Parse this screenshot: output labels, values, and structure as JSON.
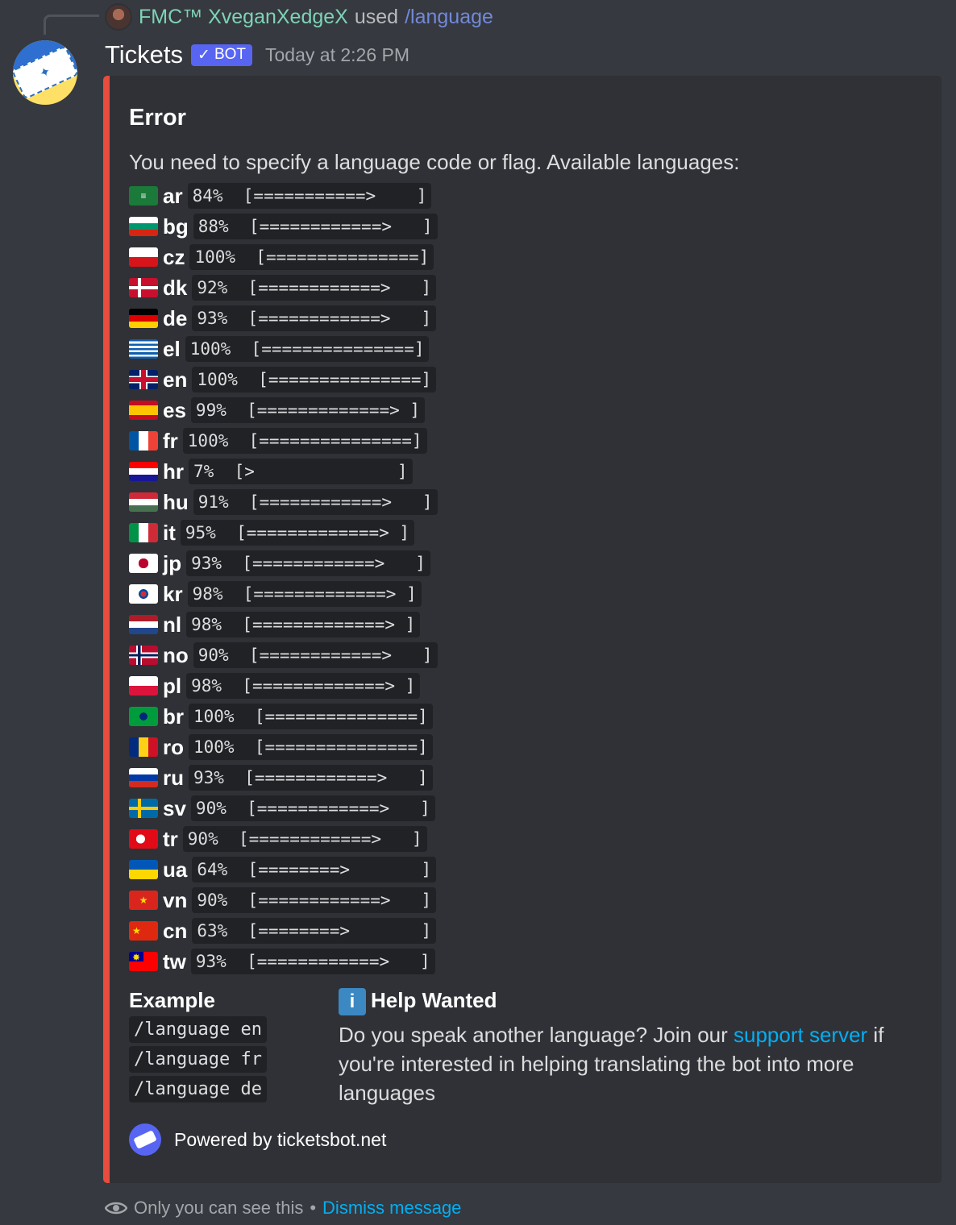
{
  "reply": {
    "username": "FMC™ XveganXedgeX",
    "used_text": "used",
    "command": "/language"
  },
  "message": {
    "author": "Tickets",
    "bot_badge": "BOT",
    "timestamp": "Today at 2:26 PM"
  },
  "embed": {
    "accent_color": "#e74c3c",
    "title": "Error",
    "description": "You need to specify a language code or flag. Available languages:",
    "languages": [
      {
        "flag": "saudi-arabia-flag-icon",
        "code": "ar",
        "bar": "84%  [===========>    ]"
      },
      {
        "flag": "bulgaria-flag-icon",
        "code": "bg",
        "bar": "88%  [============>   ]"
      },
      {
        "flag": "czech-flag-icon",
        "code": "cz",
        "bar": "100%  [===============]"
      },
      {
        "flag": "denmark-flag-icon",
        "code": "dk",
        "bar": "92%  [============>   ]"
      },
      {
        "flag": "germany-flag-icon",
        "code": "de",
        "bar": "93%  [============>   ]"
      },
      {
        "flag": "greece-flag-icon",
        "code": "el",
        "bar": "100%  [===============]"
      },
      {
        "flag": "uk-flag-icon",
        "code": "en",
        "bar": "100%  [===============]"
      },
      {
        "flag": "spain-flag-icon",
        "code": "es",
        "bar": "99%  [=============> ]"
      },
      {
        "flag": "france-flag-icon",
        "code": "fr",
        "bar": "100%  [===============]"
      },
      {
        "flag": "croatia-flag-icon",
        "code": "hr",
        "bar": "7%  [>              ]"
      },
      {
        "flag": "hungary-flag-icon",
        "code": "hu",
        "bar": "91%  [============>   ]"
      },
      {
        "flag": "italy-flag-icon",
        "code": "it",
        "bar": "95%  [=============> ]"
      },
      {
        "flag": "japan-flag-icon",
        "code": "jp",
        "bar": "93%  [============>   ]"
      },
      {
        "flag": "korea-flag-icon",
        "code": "kr",
        "bar": "98%  [=============> ]"
      },
      {
        "flag": "netherlands-flag-icon",
        "code": "nl",
        "bar": "98%  [=============> ]"
      },
      {
        "flag": "norway-flag-icon",
        "code": "no",
        "bar": "90%  [============>   ]"
      },
      {
        "flag": "poland-flag-icon",
        "code": "pl",
        "bar": "98%  [=============> ]"
      },
      {
        "flag": "brazil-flag-icon",
        "code": "br",
        "bar": "100%  [===============]"
      },
      {
        "flag": "romania-flag-icon",
        "code": "ro",
        "bar": "100%  [===============]"
      },
      {
        "flag": "russia-flag-icon",
        "code": "ru",
        "bar": "93%  [============>   ]"
      },
      {
        "flag": "sweden-flag-icon",
        "code": "sv",
        "bar": "90%  [============>   ]"
      },
      {
        "flag": "turkey-flag-icon",
        "code": "tr",
        "bar": "90%  [============>   ]"
      },
      {
        "flag": "ukraine-flag-icon",
        "code": "ua",
        "bar": "64%  [========>       ]"
      },
      {
        "flag": "vietnam-flag-icon",
        "code": "vn",
        "bar": "90%  [============>   ]"
      },
      {
        "flag": "china-flag-icon",
        "code": "cn",
        "bar": "63%  [========>       ]"
      },
      {
        "flag": "taiwan-flag-icon",
        "code": "tw",
        "bar": "93%  [============>   ]"
      }
    ],
    "example": {
      "title": "Example",
      "items": [
        "/language en",
        "/language fr",
        "/language de"
      ]
    },
    "help": {
      "title": "Help Wanted",
      "text_before": "Do you speak another language? Join our ",
      "link_text": "support server",
      "text_after": " if you're interested in helping translating the bot into more languages"
    },
    "footer": "Powered by ticketsbot.net"
  },
  "ephemeral": {
    "notice": "Only you can see this",
    "separator": "•",
    "dismiss": "Dismiss message"
  }
}
